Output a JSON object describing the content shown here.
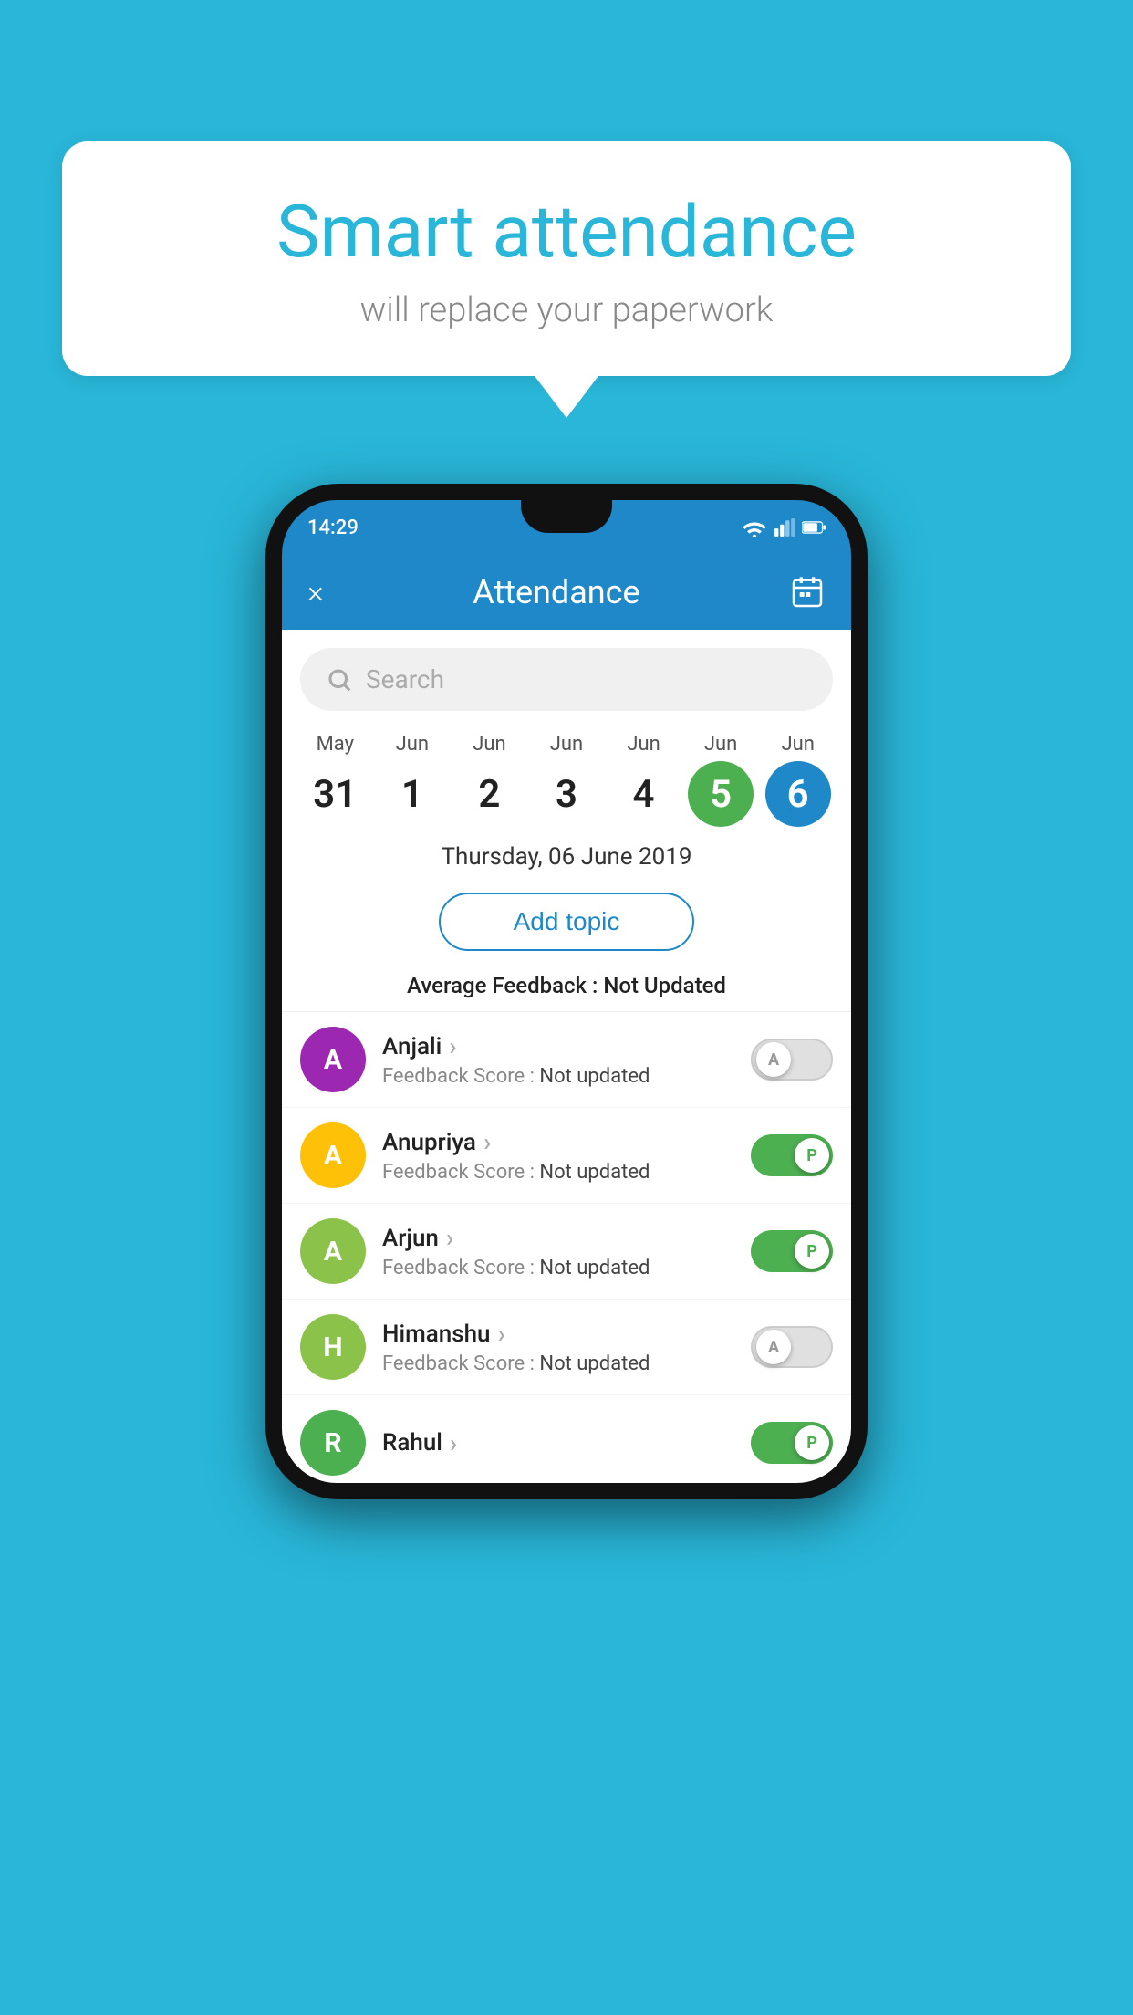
{
  "background_color": "#29B6D8",
  "bubble": {
    "title": "Smart attendance",
    "subtitle": "will replace your paperwork"
  },
  "status_bar": {
    "time": "14:29",
    "wifi_icon": "wifi",
    "signal_icon": "signal",
    "battery_icon": "battery"
  },
  "header": {
    "close_label": "×",
    "title": "Attendance",
    "calendar_icon": "calendar"
  },
  "search": {
    "placeholder": "Search"
  },
  "dates": [
    {
      "month": "May",
      "day": "31",
      "state": "normal"
    },
    {
      "month": "Jun",
      "day": "1",
      "state": "normal"
    },
    {
      "month": "Jun",
      "day": "2",
      "state": "normal"
    },
    {
      "month": "Jun",
      "day": "3",
      "state": "normal"
    },
    {
      "month": "Jun",
      "day": "4",
      "state": "normal"
    },
    {
      "month": "Jun",
      "day": "5",
      "state": "today"
    },
    {
      "month": "Jun",
      "day": "6",
      "state": "selected"
    }
  ],
  "selected_date_label": "Thursday, 06 June 2019",
  "add_topic_label": "Add topic",
  "avg_feedback_label": "Average Feedback :",
  "avg_feedback_value": "Not Updated",
  "students": [
    {
      "name": "Anjali",
      "initial": "A",
      "avatar_color": "#9C27B0",
      "feedback_label": "Feedback Score :",
      "feedback_value": "Not updated",
      "toggle_state": "off",
      "toggle_label": "A"
    },
    {
      "name": "Anupriya",
      "initial": "A",
      "avatar_color": "#FFC107",
      "feedback_label": "Feedback Score :",
      "feedback_value": "Not updated",
      "toggle_state": "on",
      "toggle_label": "P"
    },
    {
      "name": "Arjun",
      "initial": "A",
      "avatar_color": "#8BC34A",
      "feedback_label": "Feedback Score :",
      "feedback_value": "Not updated",
      "toggle_state": "on",
      "toggle_label": "P"
    },
    {
      "name": "Himanshu",
      "initial": "H",
      "avatar_color": "#8BC34A",
      "feedback_label": "Feedback Score :",
      "feedback_value": "Not updated",
      "toggle_state": "off",
      "toggle_label": "A"
    }
  ],
  "partial_student": {
    "name": "Rahul",
    "initial": "R",
    "avatar_color": "#4CAF50",
    "toggle_state": "on",
    "toggle_label": "P"
  }
}
